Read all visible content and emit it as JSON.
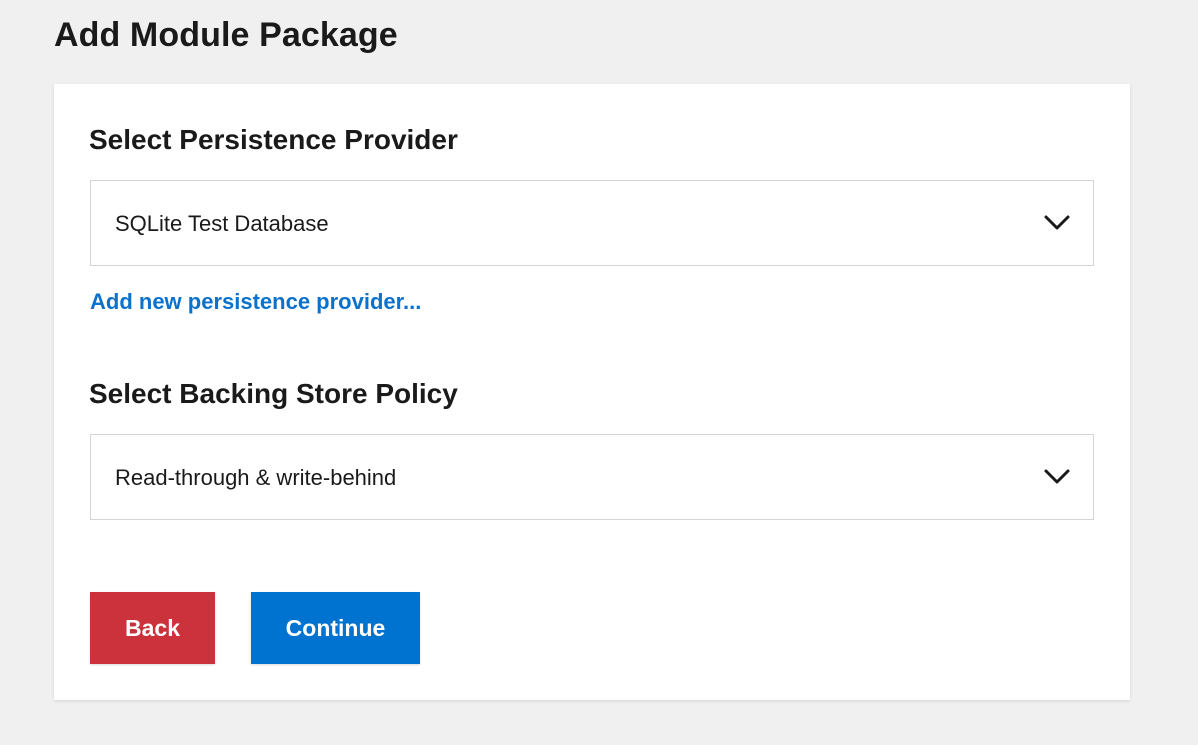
{
  "page": {
    "title": "Add Module Package"
  },
  "persistence": {
    "heading": "Select Persistence Provider",
    "selected_value": "SQLite Test Database",
    "add_link": "Add new persistence provider..."
  },
  "backing_store": {
    "heading": "Select Backing Store Policy",
    "selected_value": "Read-through & write-behind"
  },
  "actions": {
    "back_label": "Back",
    "continue_label": "Continue"
  },
  "icons": {
    "dropdown": "chevron-down-icon"
  },
  "colors": {
    "page_background": "#f0f0f0",
    "link": "#0a72cc",
    "back_button": "#cc323c",
    "continue_button": "#0072cf"
  }
}
